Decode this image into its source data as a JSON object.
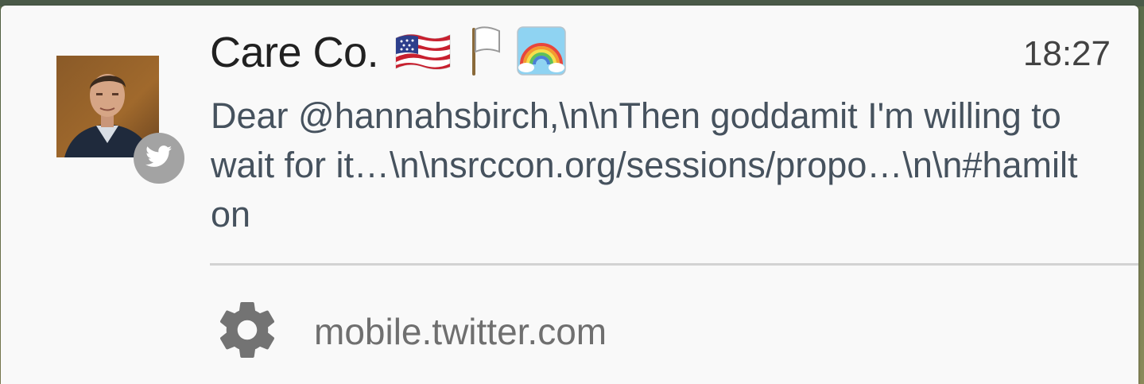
{
  "notification": {
    "sender": "Care Co.",
    "emoji_names": [
      "us-flag-icon",
      "white-flag-icon",
      "rainbow-icon"
    ],
    "time": "18:27",
    "message": "Dear @hannahsbirch,\\n\\nThen goddamit I'm willing to wait for it…\\n\\nsrccon.org/sessions/propo…\\n\\n#hamilton",
    "source_app": "mobile.twitter.com",
    "badge_icon": "twitter-bird-icon",
    "settings_icon": "gear-icon"
  },
  "colors": {
    "card_bg": "#f9f9f9",
    "sender": "#212121",
    "message": "#46525e",
    "badge_bg": "#a3a3a3",
    "source": "#6f6f6f"
  }
}
